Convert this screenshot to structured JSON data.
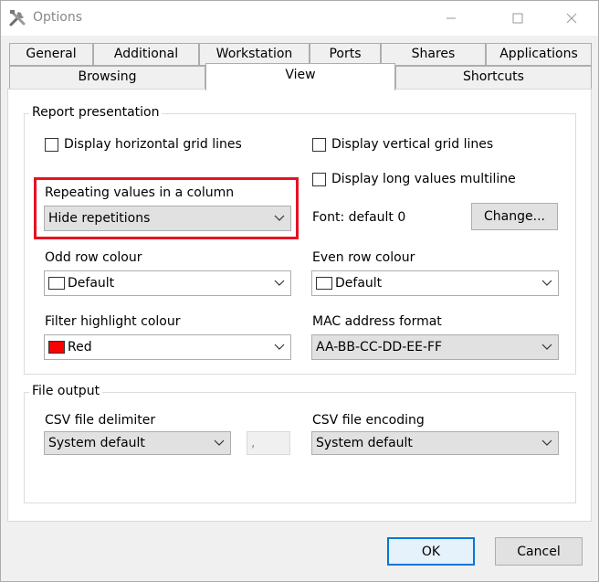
{
  "window": {
    "title": "Options",
    "icon": "tools-icon"
  },
  "tabs": {
    "row1": [
      "General",
      "Additional",
      "Workstation",
      "Ports",
      "Shares",
      "Applications"
    ],
    "row2": [
      "Browsing",
      "View",
      "Shortcuts"
    ],
    "selected": "View"
  },
  "report": {
    "title": "Report presentation",
    "display_horizontal_grid": {
      "label": "Display horizontal grid lines",
      "checked": false
    },
    "display_vertical_grid": {
      "label": "Display vertical grid lines",
      "checked": false
    },
    "display_long_multiline": {
      "label": "Display long values multiline",
      "checked": false
    },
    "repeating_label": "Repeating values in a column",
    "repeating_value": "Hide repetitions",
    "font_label": "Font: default 0",
    "change_button": "Change...",
    "odd_row_label": "Odd row colour",
    "odd_row_value": "Default",
    "even_row_label": "Even row colour",
    "even_row_value": "Default",
    "filter_label": "Filter highlight colour",
    "filter_value": "Red",
    "filter_color": "#ff0000",
    "mac_label": "MAC address format",
    "mac_value": "AA-BB-CC-DD-EE-FF"
  },
  "file_output": {
    "title": "File output",
    "csv_delim_label": "CSV file delimiter",
    "csv_delim_value": "System default",
    "csv_delim_char": ",",
    "csv_enc_label": "CSV file encoding",
    "csv_enc_value": "System default"
  },
  "buttons": {
    "ok": "OK",
    "cancel": "Cancel"
  },
  "colors": {
    "highlight_border": "#e81123",
    "default_button_border": "#0078d7"
  }
}
